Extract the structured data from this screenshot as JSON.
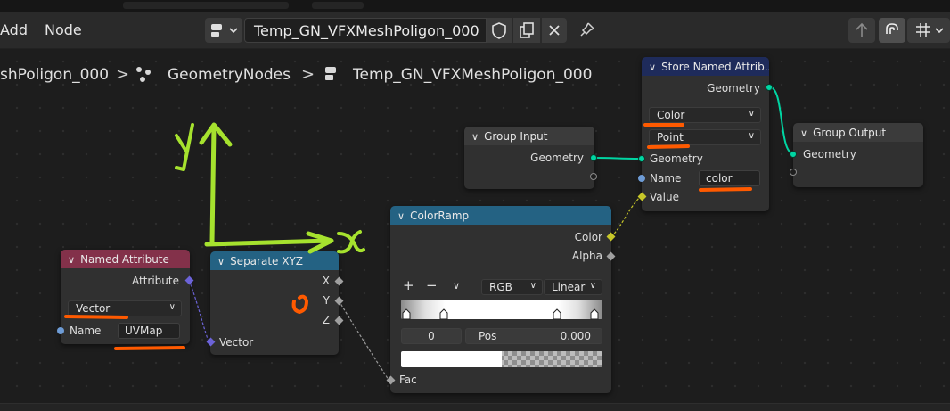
{
  "header": {
    "menu_add": "Add",
    "menu_node": "Node",
    "tree_name": "Temp_GN_VFXMeshPoligon_000"
  },
  "breadcrumb": {
    "object": "shPoligon_000",
    "modifier": "GeometryNodes",
    "tree": "Temp_GN_VFXMeshPoligon_000",
    "separator": ">"
  },
  "annotations": {
    "y_axis": "y",
    "x_axis": "x"
  },
  "nodes": {
    "group_input": {
      "title": "Group Input",
      "geometry": "Geometry"
    },
    "store_named_attribute": {
      "title": "Store Named Attrib...",
      "out_geometry": "Geometry",
      "data_type": "Color",
      "domain": "Point",
      "in_geometry": "Geometry",
      "name_label": "Name",
      "name_value": "color",
      "value_label": "Value"
    },
    "group_output": {
      "title": "Group Output",
      "geometry": "Geometry"
    },
    "color_ramp": {
      "title": "ColorRamp",
      "out_color": "Color",
      "out_alpha": "Alpha",
      "add": "+",
      "remove": "−",
      "color_mode": "RGB",
      "interpolation": "Linear",
      "index": "0",
      "pos_label": "Pos",
      "pos_value": "0.000",
      "in_fac": "Fac"
    },
    "named_attribute": {
      "title": "Named Attribute",
      "out_attribute": "Attribute",
      "data_type": "Vector",
      "name_label": "Name",
      "name_value": "UVMap"
    },
    "separate_xyz": {
      "title": "Separate XYZ",
      "out_x": "X",
      "out_y": "Y",
      "out_z": "Z",
      "in_vector": "Vector"
    }
  },
  "colors": {
    "group_header": "#3b3b3b",
    "geometry_header": "#1e2b5b",
    "converter_header": "#246283",
    "input_header": "#83314a",
    "geometry_socket": "#00d6a3",
    "annotation_green": "#a6e22e",
    "annotation_orange": "#ff5a00"
  }
}
